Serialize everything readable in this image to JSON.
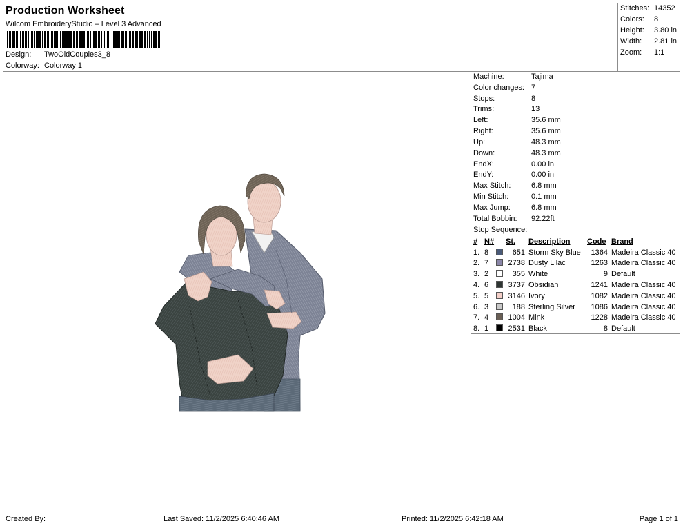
{
  "header": {
    "title": "Production Worksheet",
    "subtitle": "Wilcom EmbroideryStudio – Level 3 Advanced",
    "design_label": "Design:",
    "design_value": "TwoOldCouples3_8",
    "colorway_label": "Colorway:",
    "colorway_value": "Colorway 1"
  },
  "stats": [
    {
      "label": "Stitches:",
      "value": "14352"
    },
    {
      "label": "Colors:",
      "value": "8"
    },
    {
      "label": "Height:",
      "value": "3.80 in"
    },
    {
      "label": "Width:",
      "value": "2.81 in"
    },
    {
      "label": "Zoom:",
      "value": "1:1"
    }
  ],
  "machine_info": [
    {
      "label": "Machine:",
      "value": "Tajima"
    },
    {
      "label": "Color changes:",
      "value": "7"
    },
    {
      "label": "Stops:",
      "value": "8"
    },
    {
      "label": "Trims:",
      "value": "13"
    },
    {
      "label": "Left:",
      "value": "35.6 mm"
    },
    {
      "label": "Right:",
      "value": "35.6 mm"
    },
    {
      "label": "Up:",
      "value": "48.3 mm"
    },
    {
      "label": "Down:",
      "value": "48.3 mm"
    },
    {
      "label": "EndX:",
      "value": "0.00 in"
    },
    {
      "label": "EndY:",
      "value": "0.00 in"
    },
    {
      "label": "Max Stitch:",
      "value": "6.8 mm"
    },
    {
      "label": "Min Stitch:",
      "value": "0.1 mm"
    },
    {
      "label": "Max Jump:",
      "value": "6.8 mm"
    },
    {
      "label": "Total Bobbin:",
      "value": "92.22ft"
    }
  ],
  "stop_sequence": {
    "title": "Stop Sequence:",
    "headers": {
      "idx": "#",
      "n": "N#",
      "st": "St.",
      "desc": "Description",
      "code": "Code",
      "brand": "Brand"
    },
    "rows": [
      {
        "idx": "1.",
        "n": "8",
        "color": "#4a5a78",
        "st": "651",
        "desc": "Storm Sky Blue",
        "code": "1364",
        "brand": "Madeira Classic 40"
      },
      {
        "idx": "2.",
        "n": "7",
        "color": "#8a86a8",
        "st": "2738",
        "desc": "Dusty Lilac",
        "code": "1263",
        "brand": "Madeira Classic 40"
      },
      {
        "idx": "3.",
        "n": "2",
        "color": "#ffffff",
        "st": "355",
        "desc": "White",
        "code": "9",
        "brand": "Default"
      },
      {
        "idx": "4.",
        "n": "6",
        "color": "#2e3532",
        "st": "3737",
        "desc": "Obsidian",
        "code": "1241",
        "brand": "Madeira Classic 40"
      },
      {
        "idx": "5.",
        "n": "5",
        "color": "#f4cfc8",
        "st": "3146",
        "desc": "Ivory",
        "code": "1082",
        "brand": "Madeira Classic 40"
      },
      {
        "idx": "6.",
        "n": "3",
        "color": "#c9c9c9",
        "st": "188",
        "desc": "Sterling Silver",
        "code": "1086",
        "brand": "Madeira Classic 40"
      },
      {
        "idx": "7.",
        "n": "4",
        "color": "#6a5f55",
        "st": "1004",
        "desc": "Mink",
        "code": "1228",
        "brand": "Madeira Classic 40"
      },
      {
        "idx": "8.",
        "n": "1",
        "color": "#000000",
        "st": "2531",
        "desc": "Black",
        "code": "8",
        "brand": "Default"
      }
    ]
  },
  "footer": {
    "created_by": "Created By:",
    "last_saved": "Last Saved: 11/2/2025 6:40:46 AM",
    "printed": "Printed: 11/2/2025 6:42:18 AM",
    "page": "Page 1 of 1"
  }
}
